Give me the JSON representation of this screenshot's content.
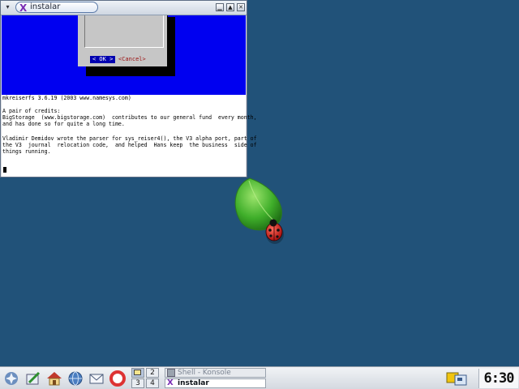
{
  "window": {
    "title": "instalar",
    "menu_glyph": "▾",
    "min_glyph": "▁",
    "max_glyph": "▲",
    "close_glyph": "✕"
  },
  "dialog": {
    "ok_label": "< OK >",
    "cancel_label": "<Cancel>"
  },
  "terminal": {
    "lines": [
      "mkreiserfs 3.6.19 (2003 www.namesys.com)",
      "",
      "A pair of credits:",
      "BigStorage  (www.bigstorage.com)  contributes to our general fund  every month,",
      "and has done so for quite a long time.",
      "",
      "Vladimir Demidov wrote the parser for sys_reiser4(), the V3 alpha port, part of",
      "the V3  journal  relocation code,  and helped  Hans keep  the business  side of",
      "things running."
    ]
  },
  "taskbar": {
    "launchers": [
      "kmenu-icon",
      "control-center-icon",
      "home-icon",
      "network-icon",
      "mail-icon",
      "help-icon"
    ],
    "pager": {
      "desk1": "1",
      "desk2": "2",
      "desk3": "3",
      "desk4": "4"
    },
    "tasks": [
      {
        "label": "Shell - Konsole",
        "active": false
      },
      {
        "label": "instalar",
        "active": true
      }
    ],
    "clock": "6:30"
  },
  "colors": {
    "desktop": "#215279",
    "dialog_blue": "#0000f0"
  }
}
